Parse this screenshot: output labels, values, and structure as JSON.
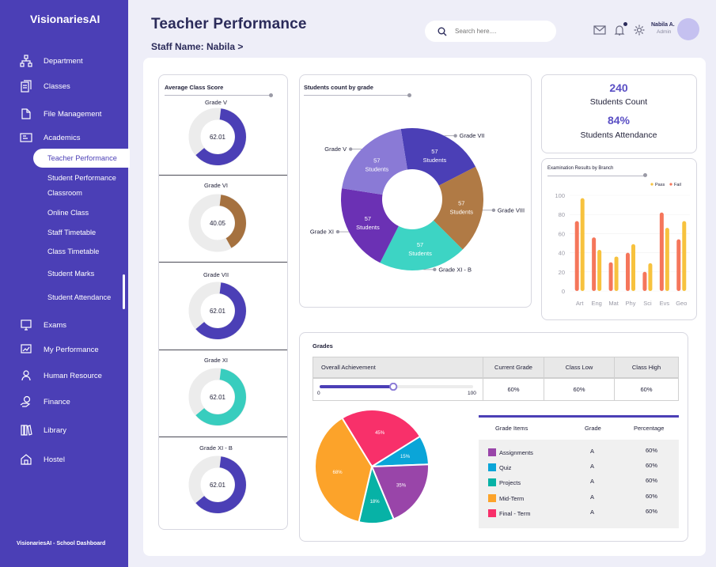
{
  "sidebar": {
    "brand": "VisionariesAI",
    "items": [
      {
        "label": "Department",
        "icon": "department-icon"
      },
      {
        "label": "Classes",
        "icon": "classes-icon"
      },
      {
        "label": "File Management",
        "icon": "file-icon"
      },
      {
        "label": "Academics",
        "icon": "academics-icon"
      },
      {
        "label": "Exams",
        "icon": "exams-icon"
      },
      {
        "label": "My Performance",
        "icon": "performance-icon"
      },
      {
        "label": "Human Resource",
        "icon": "hr-icon"
      },
      {
        "label": "Finance",
        "icon": "finance-icon"
      },
      {
        "label": "Library",
        "icon": "library-icon"
      },
      {
        "label": "Hostel",
        "icon": "hostel-icon"
      }
    ],
    "sub_items": [
      "Teacher Performance",
      "Student Performance",
      "Classroom",
      "Online Class",
      "Staff Timetable",
      "Class Timetable",
      "Student Marks",
      "Student Attendance"
    ],
    "footer": "VisionariesAI - School Dashboard"
  },
  "header": {
    "title": "Teacher Performance",
    "staff": "Staff Name: Nabila >",
    "search_placeholder": "Search here....",
    "user_name": "Nabila A.",
    "user_role": "Admin"
  },
  "average_class_score": {
    "title": "Average Class Score",
    "grades": [
      {
        "label": "Grade V",
        "value": "62.01",
        "fraction": 0.6201,
        "color": "#4b3fb6"
      },
      {
        "label": "Grade VI",
        "value": "40.05",
        "fraction": 0.4005,
        "color": "#a5713f"
      },
      {
        "label": "Grade VII",
        "value": "62.01",
        "fraction": 0.6201,
        "color": "#4b3fb6"
      },
      {
        "label": "Grade XI",
        "value": "62.01",
        "fraction": 0.6201,
        "color": "#38cdbe"
      },
      {
        "label": "Grade XI - B",
        "value": "62.01",
        "fraction": 0.6201,
        "color": "#4b3fb6"
      }
    ]
  },
  "students_by_grade": {
    "title": "Students count by grade",
    "segment_text": "Students",
    "segments": [
      {
        "label": "Grade VII",
        "value": 57,
        "color": "#4b3fb6"
      },
      {
        "label": "Grade VIII",
        "value": 57,
        "color": "#b07a45"
      },
      {
        "label": "Grade XI - B",
        "value": 57,
        "color": "#3dd4c4"
      },
      {
        "label": "Grade XI",
        "value": 57,
        "color": "#6b31b4"
      },
      {
        "label": "Grade V",
        "value": 57,
        "color": "#8a7ad6"
      }
    ]
  },
  "stats": {
    "students_count": "240",
    "students_count_label": "Students Count",
    "attendance": "84%",
    "attendance_label": "Students Attendance"
  },
  "chart_data": {
    "type": "bar",
    "title": "Examination Results by Branch",
    "categories": [
      "Art",
      "Eng",
      "Mat",
      "Phy",
      "Sci",
      "Evs",
      "Geo"
    ],
    "series": [
      {
        "name": "Pass",
        "color": "#f7c23e",
        "values": [
          97,
          43,
          36,
          49,
          29,
          66,
          73
        ]
      },
      {
        "name": "Fail",
        "color": "#f5765b",
        "values": [
          73,
          56,
          30,
          40,
          20,
          82,
          54
        ]
      }
    ],
    "ylim": [
      0,
      100
    ],
    "yticks": [
      0,
      20,
      40,
      60,
      80,
      100
    ],
    "legend": "top-right"
  },
  "grades": {
    "title": "Grades",
    "achievement": {
      "headers": [
        "Overall Achievement",
        "Current Grade",
        "Class Low",
        "Class High"
      ],
      "progress": 0.48,
      "min": "0",
      "max": "100",
      "current_grade": "60%",
      "class_low": "60%",
      "class_high": "60%"
    },
    "pie": [
      {
        "label": "45%",
        "value": 45,
        "color": "#f8306a"
      },
      {
        "label": "15%",
        "value": 15,
        "color": "#0aa5d8"
      },
      {
        "label": "35%",
        "value": 35,
        "color": "#9945a9"
      },
      {
        "label": "18%",
        "value": 18,
        "color": "#07b2a6"
      },
      {
        "label": "68%",
        "value": 68,
        "color": "#fca32a"
      }
    ],
    "items_headers": [
      "Grade Items",
      "Grade",
      "Percentage"
    ],
    "items": [
      {
        "name": "Assignments",
        "grade": "A",
        "percentage": "60%",
        "color": "#9945a9"
      },
      {
        "name": "Quiz",
        "grade": "A",
        "percentage": "60%",
        "color": "#0aa5d8"
      },
      {
        "name": "Projects",
        "grade": "A",
        "percentage": "60%",
        "color": "#07b2a6"
      },
      {
        "name": "Mid-Term",
        "grade": "A",
        "percentage": "60%",
        "color": "#fca32a"
      },
      {
        "name": "Final - Term",
        "grade": "A",
        "percentage": "60%",
        "color": "#f8306a"
      }
    ]
  }
}
